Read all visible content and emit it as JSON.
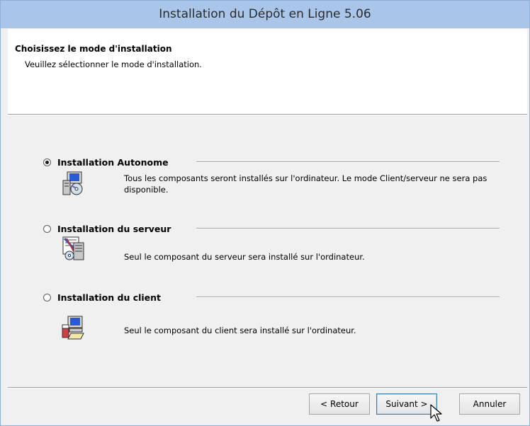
{
  "window": {
    "title": "Installation du Dépôt en Ligne 5.06"
  },
  "header": {
    "title": "Choisissez le mode d'installation",
    "subtitle": "Veuillez sélectionner le mode d'installation."
  },
  "options": [
    {
      "label": "Installation Autonome",
      "selected": true,
      "icon": "standalone-computer-cd-icon",
      "description": "Tous les composants seront installés sur l'ordinateur. Le mode Client/serveur ne sera pas disponible."
    },
    {
      "label": "Installation du serveur",
      "selected": false,
      "icon": "server-document-icon",
      "description": "Seul le composant du serveur sera installé sur l'ordinateur."
    },
    {
      "label": "Installation du client",
      "selected": false,
      "icon": "client-computer-icon",
      "description": "Seul le composant du client sera installé sur l'ordinateur."
    }
  ],
  "buttons": {
    "back": "< Retour",
    "next": "Suivant >",
    "cancel": "Annuler"
  },
  "colors": {
    "titlebar": "#a9c5ea",
    "header_bg": "#ffffff",
    "dialog_bg": "#f0f0f0"
  }
}
